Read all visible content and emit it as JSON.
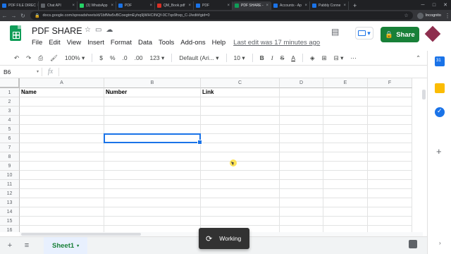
{
  "browser": {
    "tabs": [
      {
        "label": "PDF FILE DIREC",
        "color": "#1a73e8"
      },
      {
        "label": "Chat API",
        "color": "#5f6368"
      },
      {
        "label": "(3) WhatsApp",
        "color": "#25d366"
      },
      {
        "label": "PDF",
        "color": "#1a73e8"
      },
      {
        "label": "QM_Book.pdf",
        "color": "#d93025"
      },
      {
        "label": "PDF",
        "color": "#1a73e8"
      },
      {
        "label": "PDF SHARE - ",
        "color": "#0f9d58"
      },
      {
        "label": "Accounts - Ap",
        "color": "#1a73e8"
      },
      {
        "label": "Pabbly Conne",
        "color": "#1a73e8"
      }
    ],
    "url": "docs.google.com/spreadsheets/d/1bfMw5vBCoegtmEyhq9jWHCINQf-0C7qo9hxp_C-J/edit#gid=0",
    "profile": "Incognito"
  },
  "doc": {
    "title": "PDF SHARE",
    "last_edit": "Last edit was 17 minutes ago"
  },
  "menu": [
    "File",
    "Edit",
    "View",
    "Insert",
    "Format",
    "Data",
    "Tools",
    "Add-ons",
    "Help"
  ],
  "header": {
    "share_label": "Share"
  },
  "toolbar": {
    "zoom": "100%",
    "currency": "$",
    "percent": "%",
    "dec_less": ".0",
    "dec_more": ".00",
    "format_more": "123",
    "font": "Default (Ari...",
    "font_size": "10",
    "bold": "B",
    "italic": "I",
    "strike": "S",
    "text_color": "A"
  },
  "formula_bar": {
    "cell_ref": "B6",
    "fx": "fx",
    "value": ""
  },
  "grid": {
    "columns": [
      "A",
      "B",
      "C",
      "D",
      "E",
      "F"
    ],
    "rows": [
      "1",
      "2",
      "3",
      "4",
      "5",
      "6",
      "7",
      "8",
      "9",
      "10",
      "11",
      "12",
      "13",
      "14",
      "15",
      "16"
    ],
    "headers": {
      "A": "Name",
      "B": "Number",
      "C": "Link"
    },
    "selected_cell": "B6"
  },
  "sheets": [
    {
      "label": "Sheet1",
      "active": true
    }
  ],
  "toast": {
    "label": "Working"
  }
}
